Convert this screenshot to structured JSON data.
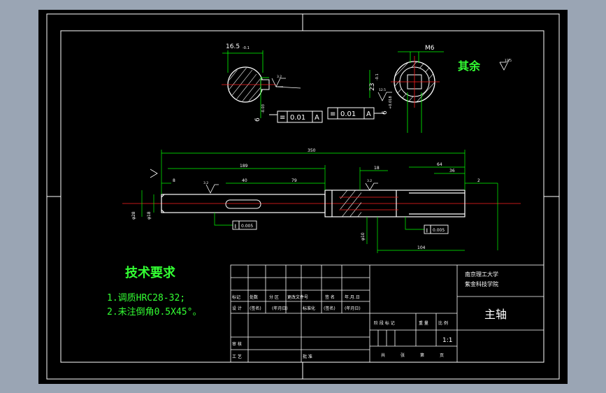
{
  "drawing": {
    "colors": {
      "background": "#000000",
      "frame": "#ffffff",
      "part": "#ffffff",
      "dimension": "#00ff00",
      "centerline": "#ff2020",
      "hatch": "#ffffff",
      "text_green": "#33ff33",
      "canvas_bg": "#9aa5b4"
    },
    "section_a": {
      "dim_top": "16.5",
      "dim_tol": "-0.1",
      "dim_side": "6",
      "dim_side_tol": "-0.03",
      "roughness": "3.2"
    },
    "section_b": {
      "thread": "M6",
      "dim_side": "23",
      "dim_side_tol": "-0.1",
      "dim_bottom": "6",
      "dim_bottom_tol": "+0.018",
      "roughness": "12.5"
    },
    "tolerance_frames": [
      {
        "symbol": "≡",
        "value": "0.01",
        "datum": "A"
      },
      {
        "symbol": "≡",
        "value": "0.01",
        "datum": "A"
      }
    ],
    "other_surfaces": {
      "label": "其余",
      "roughness": "12.5"
    },
    "main_view": {
      "dim_total": "350",
      "dim_189": "189",
      "dim_40": "40",
      "dim_79": "79",
      "dim_8": "8",
      "dim_18": "18",
      "dim_64": "64",
      "dim_36": "36",
      "dim_2": "2",
      "dim_104": "104",
      "dia_left": "φ28",
      "dia_left2": "φ18",
      "dia_right": "φ10",
      "runout_left": "0.005",
      "runout_right": "0.005",
      "roughness_left": "3.2",
      "roughness_right": "3.2"
    },
    "tech_req": {
      "title": "技术要求",
      "items": [
        "1.调质HRC28-32;",
        "2.未注倒角0.5X45°。"
      ]
    },
    "title_block": {
      "school_line1": "南京理工大学",
      "school_line2": "紫金科技学院",
      "part_name": "主轴",
      "scale": "1:1",
      "row_labels": [
        "标记",
        "处数",
        "分 区",
        "更改文件号",
        "签 名",
        "年.月.日"
      ],
      "row2": [
        "设 计",
        "(签名)",
        "(年月日)",
        "标准化",
        "(签名)",
        "(年月日)"
      ],
      "stage_labels": [
        "阶 段 标 记",
        "重 量",
        "比 例"
      ],
      "review": "审 核",
      "craft": "工 艺",
      "approve": "批 准",
      "sheets": [
        "共",
        "张",
        "第",
        "页"
      ]
    }
  }
}
